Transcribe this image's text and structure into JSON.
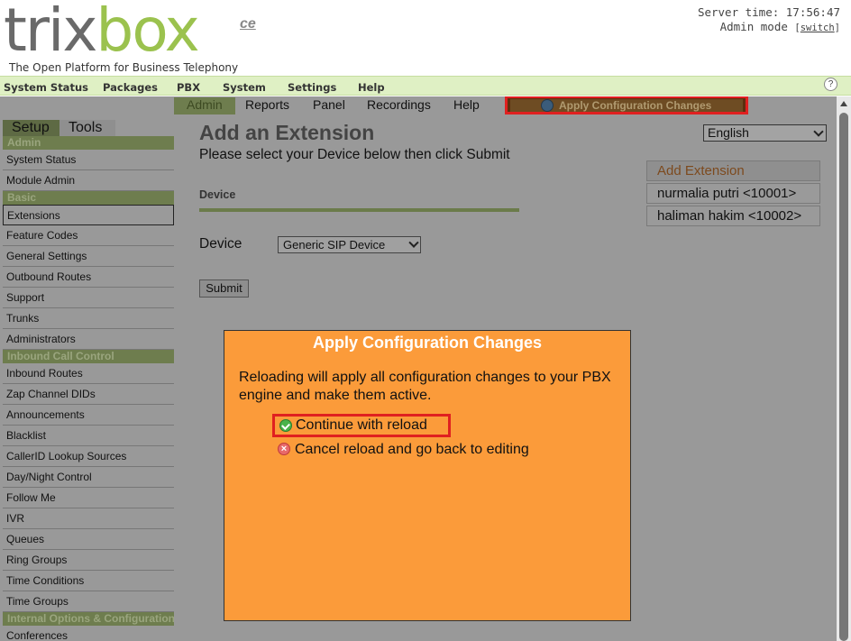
{
  "header": {
    "logo_part1": "trix",
    "logo_part2": "box",
    "logo_suffix": "ce",
    "tagline": "The Open Platform for Business Telephony",
    "server_time": "Server time: 17:56:47",
    "admin_mode": "Admin mode",
    "switch_label": "switch"
  },
  "top_nav": {
    "items": [
      "System Status",
      "Packages",
      "PBX",
      "System",
      "Settings",
      "Help"
    ],
    "help_icon": "?"
  },
  "module_tabs": {
    "items": [
      "Admin",
      "Reports",
      "Panel",
      "Recordings",
      "Help"
    ],
    "apply_label": "Apply Configuration Changes"
  },
  "sidebar": {
    "tabs": [
      "Setup",
      "Tools"
    ],
    "sections": [
      {
        "title": "Admin",
        "items": [
          "System Status",
          "Module Admin"
        ]
      },
      {
        "title": "Basic",
        "items": [
          "Extensions",
          "Feature Codes",
          "General Settings",
          "Outbound Routes",
          "Support",
          "Trunks",
          "Administrators"
        ]
      },
      {
        "title": "Inbound Call Control",
        "items": [
          "Inbound Routes",
          "Zap Channel DIDs",
          "Announcements",
          "Blacklist",
          "CallerID Lookup Sources",
          "Day/Night Control",
          "Follow Me",
          "IVR",
          "Queues",
          "Ring Groups",
          "Time Conditions",
          "Time Groups"
        ]
      },
      {
        "title": "Internal Options & Configuration",
        "items": [
          "Conferences"
        ]
      }
    ]
  },
  "main": {
    "title": "Add an Extension",
    "subtitle": "Please select your Device below then click Submit",
    "section_header": "Device",
    "device_label": "Device",
    "device_value": "Generic SIP Device",
    "submit_label": "Submit"
  },
  "language": {
    "value": "English"
  },
  "extensions": {
    "add_label": "Add Extension",
    "items": [
      "nurmalia putri <10001>",
      "haliman hakim <10002>"
    ]
  },
  "modal": {
    "title": "Apply Configuration Changes",
    "message": "Reloading will apply all configuration changes to your PBX engine and make them active.",
    "continue_label": "Continue with reload",
    "cancel_label": "Cancel reload and go back to editing"
  }
}
